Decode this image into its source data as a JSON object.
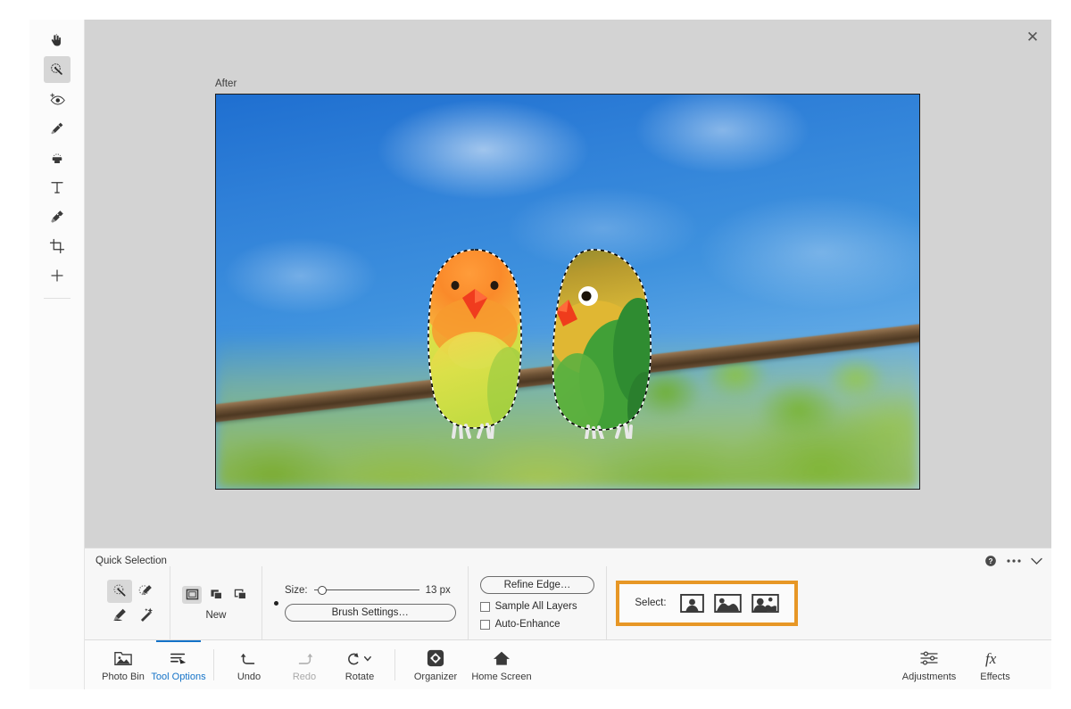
{
  "app": {
    "close_label": "✕"
  },
  "toolbar": {
    "tools": [
      {
        "name": "move-hand-tool",
        "label": "Move"
      },
      {
        "name": "quick-selection-tool",
        "label": "Quick Selection"
      },
      {
        "name": "red-eye-tool",
        "label": "Eye"
      },
      {
        "name": "spot-healing-brush-tool",
        "label": "Spot Healing Brush"
      },
      {
        "name": "clone-stamp-tool",
        "label": "Clone Stamp"
      },
      {
        "name": "text-tool",
        "label": "Type"
      },
      {
        "name": "brush-tool",
        "label": "Brush"
      },
      {
        "name": "crop-tool",
        "label": "Crop"
      },
      {
        "name": "more-tools",
        "label": "More"
      }
    ]
  },
  "canvas": {
    "view_label": "After",
    "image_alt": "Two lovebirds perched on a branch with an active selection outline"
  },
  "options": {
    "title": "Quick Selection",
    "mode": {
      "label": "New",
      "buttons": [
        "New selection",
        "Add to selection",
        "Subtract from selection"
      ]
    },
    "size": {
      "label": "Size:",
      "value": "13 px",
      "slider_percent": 0
    },
    "brush_settings_label": "Brush Settings…",
    "refine_edge_label": "Refine Edge…",
    "checkboxes": [
      {
        "label": "Sample All Layers",
        "checked": false
      },
      {
        "label": "Auto-Enhance",
        "checked": false
      }
    ],
    "select": {
      "label": "Select:",
      "options": [
        "Subject",
        "Sky",
        "Subject and Sky"
      ],
      "highlight_color": "#e79726"
    },
    "corner": {
      "help": "help-icon",
      "more": "ellipsis-icon",
      "collapse": "chevron-down-icon"
    }
  },
  "taskbar": {
    "left": [
      {
        "label": "Photo Bin",
        "icon": "photo-bin-icon",
        "active": false,
        "disabled": false
      },
      {
        "label": "Tool Options",
        "icon": "tool-options-icon",
        "active": true,
        "disabled": false
      },
      {
        "label": "Undo",
        "icon": "undo-icon",
        "active": false,
        "disabled": false
      },
      {
        "label": "Redo",
        "icon": "redo-icon",
        "active": false,
        "disabled": true
      },
      {
        "label": "Rotate",
        "icon": "rotate-icon",
        "active": false,
        "disabled": false
      },
      {
        "label": "Organizer",
        "icon": "organizer-icon",
        "active": false,
        "disabled": false
      },
      {
        "label": "Home Screen",
        "icon": "home-icon",
        "active": false,
        "disabled": false
      }
    ],
    "right": [
      {
        "label": "Adjustments",
        "icon": "adjustments-icon"
      },
      {
        "label": "Effects",
        "icon": "effects-icon"
      }
    ]
  },
  "colors": {
    "accent_blue": "#1473c8",
    "highlight_orange": "#e79726",
    "panel_bg": "#f7f7f7",
    "canvas_bg": "#d3d3d3"
  }
}
